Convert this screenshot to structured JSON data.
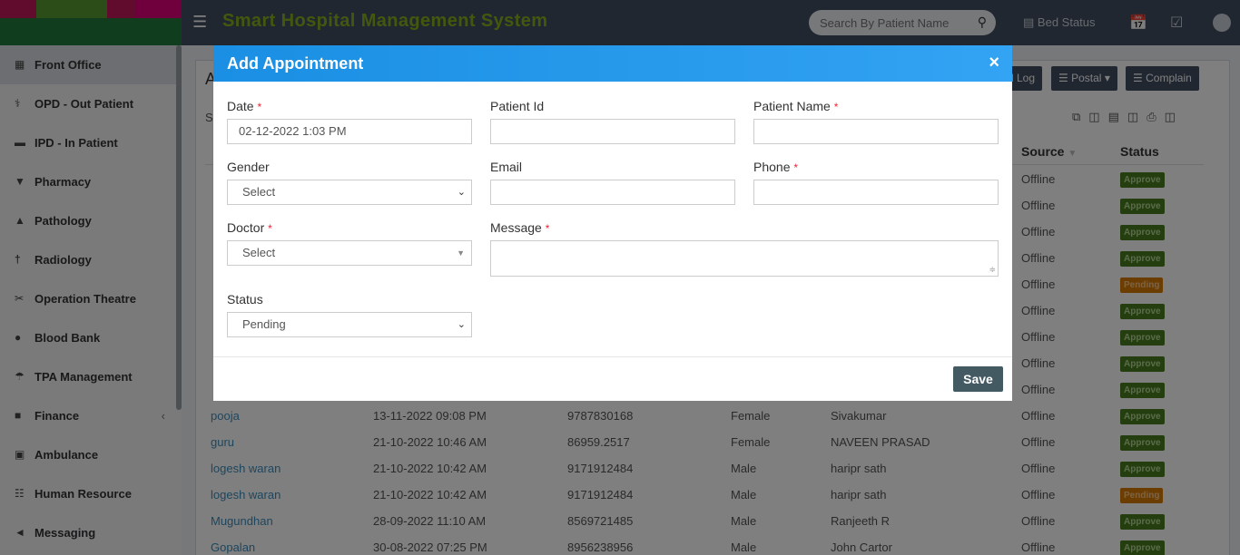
{
  "header": {
    "title": "Smart Hospital Management System",
    "search_placeholder": "Search By Patient Name",
    "bed_status": "Bed Status"
  },
  "sidebar": {
    "items": [
      {
        "label": "Front Office",
        "icon": "building-icon"
      },
      {
        "label": "OPD - Out Patient",
        "icon": "stethoscope-icon"
      },
      {
        "label": "IPD - In Patient",
        "icon": "bed-icon"
      },
      {
        "label": "Pharmacy",
        "icon": "mortar-pestle-icon"
      },
      {
        "label": "Pathology",
        "icon": "flask-icon"
      },
      {
        "label": "Radiology",
        "icon": "microscope-icon"
      },
      {
        "label": "Operation Theatre",
        "icon": "scissors-icon"
      },
      {
        "label": "Blood Bank",
        "icon": "tint-icon"
      },
      {
        "label": "TPA Management",
        "icon": "umbrella-icon"
      },
      {
        "label": "Finance",
        "icon": "money-icon"
      },
      {
        "label": "Ambulance",
        "icon": "ambulance-icon"
      },
      {
        "label": "Human Resource",
        "icon": "sitemap-icon"
      },
      {
        "label": "Messaging",
        "icon": "bullhorn-icon"
      }
    ]
  },
  "page": {
    "title_initial": "A",
    "search_initial": "S",
    "toolbar": {
      "call_log": "l Log",
      "postal": "Postal",
      "complain": "Complain"
    },
    "columns": {
      "source": "Source",
      "status": "Status"
    },
    "rows": [
      {
        "name": "",
        "date": "",
        "phone": "",
        "gender": "",
        "doctor": "",
        "source": "Offline",
        "status": "Approve"
      },
      {
        "name": "",
        "date": "",
        "phone": "",
        "gender": "",
        "doctor": "",
        "source": "Offline",
        "status": "Approve"
      },
      {
        "name": "",
        "date": "",
        "phone": "",
        "gender": "",
        "doctor": "",
        "source": "Offline",
        "status": "Approve"
      },
      {
        "name": "",
        "date": "",
        "phone": "",
        "gender": "",
        "doctor": "",
        "source": "Offline",
        "status": "Approve"
      },
      {
        "name": "",
        "date": "",
        "phone": "",
        "gender": "",
        "doctor": "",
        "source": "Offline",
        "status": "Pending"
      },
      {
        "name": "",
        "date": "",
        "phone": "",
        "gender": "",
        "doctor": "",
        "source": "Offline",
        "status": "Approve"
      },
      {
        "name": "",
        "date": "",
        "phone": "",
        "gender": "",
        "doctor": "",
        "source": "Offline",
        "status": "Approve"
      },
      {
        "name": "",
        "date": "",
        "phone": "",
        "gender": "",
        "doctor": "",
        "source": "Offline",
        "status": "Approve"
      },
      {
        "name": "",
        "date": "",
        "phone": "",
        "gender": "",
        "doctor": "",
        "source": "Offline",
        "status": "Approve"
      },
      {
        "name": "pooja",
        "date": "13-11-2022 09:08 PM",
        "phone": "9787830168",
        "gender": "Female",
        "doctor": "Sivakumar",
        "source": "Offline",
        "status": "Approve"
      },
      {
        "name": "guru",
        "date": "21-10-2022 10:46 AM",
        "phone": "86959.2517",
        "gender": "Female",
        "doctor": "NAVEEN PRASAD",
        "source": "Offline",
        "status": "Approve"
      },
      {
        "name": "logesh waran",
        "date": "21-10-2022 10:42 AM",
        "phone": "9171912484",
        "gender": "Male",
        "doctor": "haripr sath",
        "source": "Offline",
        "status": "Approve"
      },
      {
        "name": "logesh waran",
        "date": "21-10-2022 10:42 AM",
        "phone": "9171912484",
        "gender": "Male",
        "doctor": "haripr sath",
        "source": "Offline",
        "status": "Pending"
      },
      {
        "name": "Mugundhan",
        "date": "28-09-2022 11:10 AM",
        "phone": "8569721485",
        "gender": "Male",
        "doctor": "Ranjeeth R",
        "source": "Offline",
        "status": "Approve"
      },
      {
        "name": "Gopalan",
        "date": "30-08-2022 07:25 PM",
        "phone": "8956238956",
        "gender": "Male",
        "doctor": "John Cartor",
        "source": "Offline",
        "status": "Approve"
      }
    ]
  },
  "modal": {
    "title": "Add Appointment",
    "close": "×",
    "date_label": "Date",
    "date_value": "02-12-2022 1:03 PM",
    "patient_id_label": "Patient Id",
    "patient_name_label": "Patient Name",
    "gender_label": "Gender",
    "gender_value": "Select",
    "email_label": "Email",
    "phone_label": "Phone",
    "doctor_label": "Doctor",
    "doctor_value": "Select",
    "message_label": "Message",
    "status_label": "Status",
    "status_value": "Pending",
    "required_mark": "*",
    "save_label": "Save"
  },
  "colors": {
    "header": "#424f63",
    "modal_header": "#1a8fe3",
    "brand": "#86b01d",
    "approve": "#4a7d20",
    "pending": "#d97a00"
  }
}
